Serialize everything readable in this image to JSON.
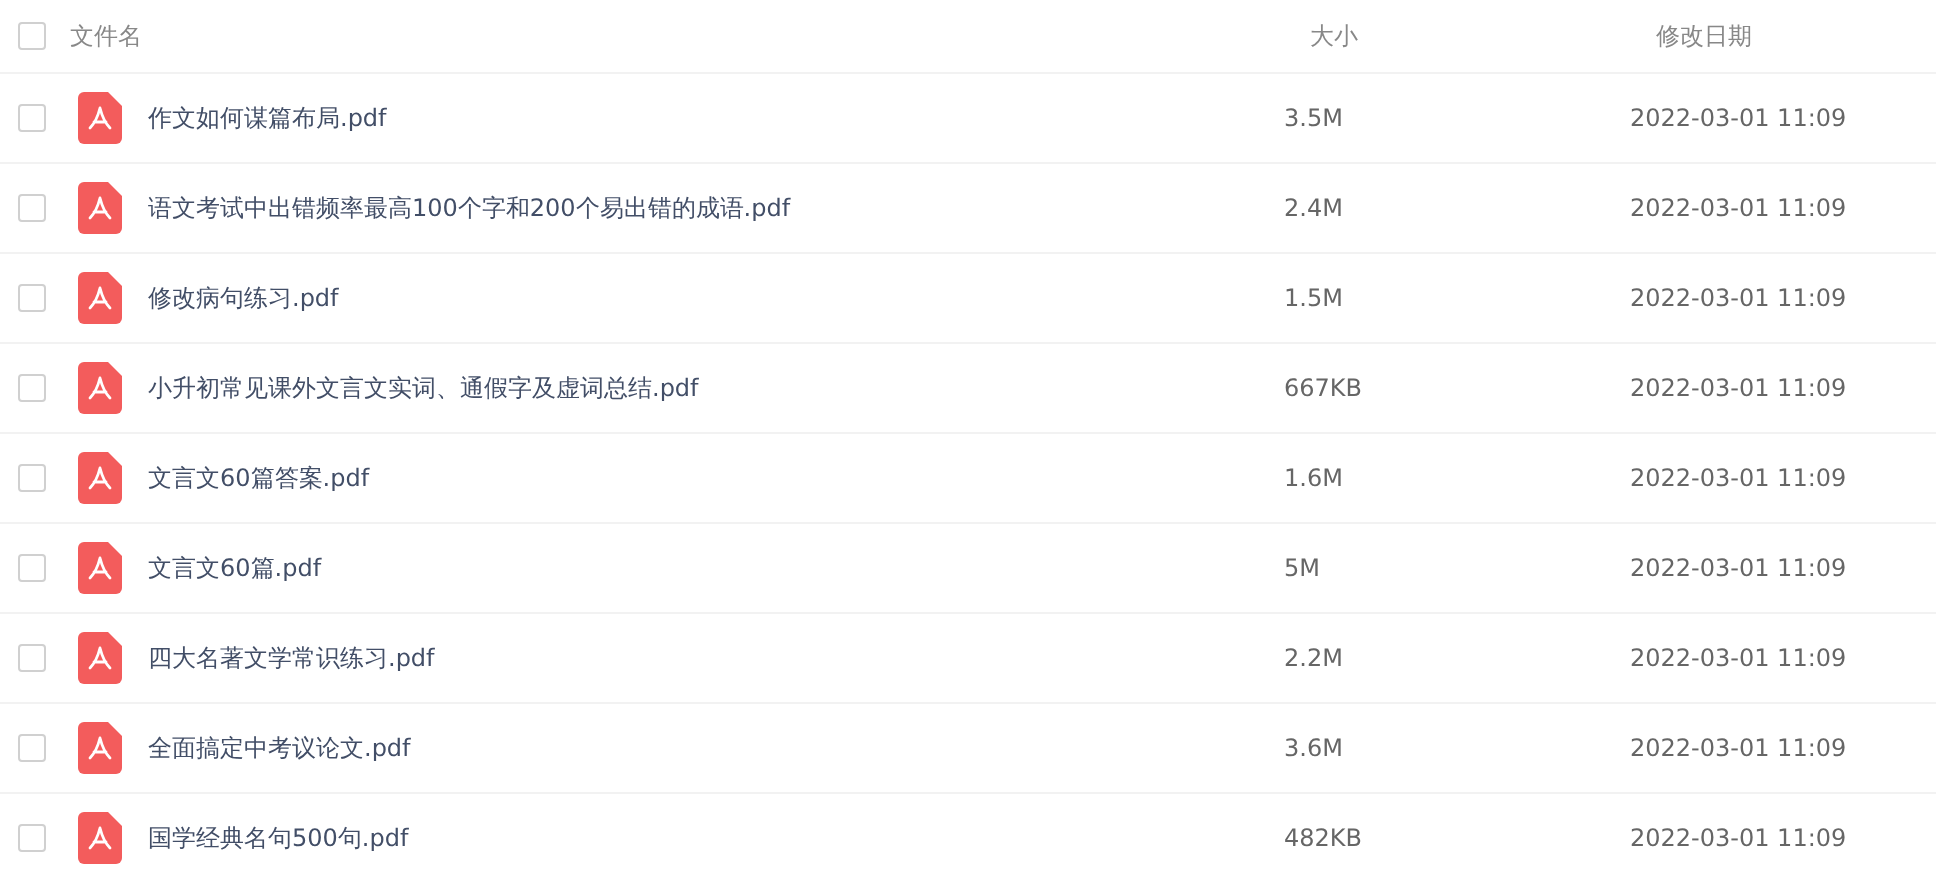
{
  "table": {
    "header": {
      "checked": false,
      "columns": [
        "文件名",
        "大小",
        "修改日期"
      ]
    },
    "rows": [
      {
        "checked": false,
        "name": "作文如何谋篇布局.pdf",
        "size": "3.5M",
        "date": "2022-03-01 11:09"
      },
      {
        "checked": false,
        "name": "语文考试中出错频率最高100个字和200个易出错的成语.pdf",
        "size": "2.4M",
        "date": "2022-03-01 11:09"
      },
      {
        "checked": false,
        "name": "修改病句练习.pdf",
        "size": "1.5M",
        "date": "2022-03-01 11:09"
      },
      {
        "checked": false,
        "name": "小升初常见课外文言文实词、通假字及虚词总结.pdf",
        "size": "667KB",
        "date": "2022-03-01 11:09"
      },
      {
        "checked": false,
        "name": "文言文60篇答案.pdf",
        "size": "1.6M",
        "date": "2022-03-01 11:09"
      },
      {
        "checked": false,
        "name": "文言文60篇.pdf",
        "size": "5M",
        "date": "2022-03-01 11:09"
      },
      {
        "checked": false,
        "name": "四大名著文学常识练习.pdf",
        "size": "2.2M",
        "date": "2022-03-01 11:09"
      },
      {
        "checked": false,
        "name": "全面搞定中考议论文.pdf",
        "size": "3.6M",
        "date": "2022-03-01 11:09"
      },
      {
        "checked": false,
        "name": "国学经典名句500句.pdf",
        "size": "482KB",
        "date": "2022-03-01 11:09"
      }
    ]
  }
}
